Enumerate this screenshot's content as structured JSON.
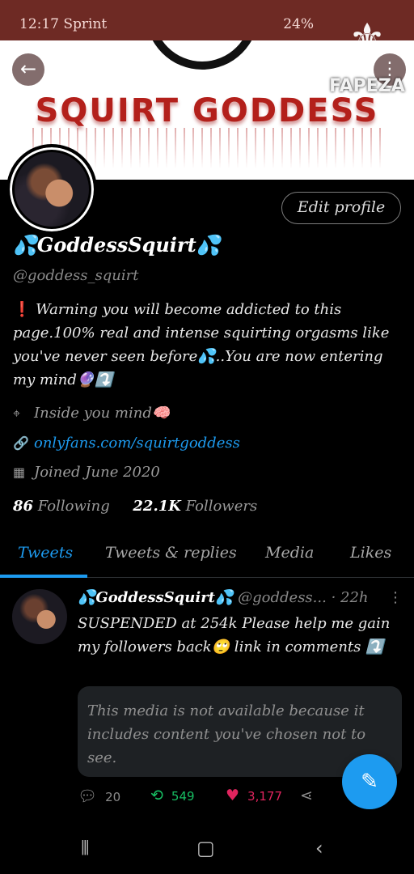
{
  "status_bar": {
    "time": "12:17 Sprint",
    "icons": "⏰ 🔇 ᯤ ▮",
    "battery": "24%"
  },
  "watermark": {
    "text": "FAPEZA"
  },
  "banner": {
    "title": "SQUIRT GODDESS"
  },
  "profile": {
    "edit_label": "Edit profile",
    "display_name": "💦GoddessSquirt💦",
    "handle": "@goddess_squirt",
    "bio_warn": "❗",
    "bio": "Warning you will become addicted to this page.100% real and intense squirting orgasms like you've never seen before💦..You are now entering my mind🔮⤵️",
    "location": "Inside you mind🧠",
    "website": "onlyfans.com/squirtgoddess",
    "joined": "Joined June 2020",
    "following_count": "86",
    "following_label": "Following",
    "followers_count": "22.1K",
    "followers_label": "Followers"
  },
  "tabs": [
    "Tweets",
    "Tweets & replies",
    "Media",
    "Likes"
  ],
  "tweet": {
    "name": "💦GoddessSquirt💦",
    "handle": "@goddess...",
    "time": "· 22h",
    "text": "SUSPENDED at 254k Please help me gain my followers back🙄 link in comments ⤵️",
    "media_notice": "This media is not available because it includes content you've chosen not to see.",
    "replies": "20",
    "retweets": "549",
    "likes": "3,177"
  },
  "icons": {
    "back": "arrow-left-icon",
    "more": "more-vertical-icon",
    "location": "map-pin-icon",
    "link": "link-icon",
    "calendar": "calendar-icon",
    "reply": "reply-icon",
    "retweet": "retweet-icon",
    "like": "heart-icon",
    "share": "share-icon",
    "compose": "compose-icon"
  },
  "colors": {
    "status_bar": "#6e2a24",
    "accent": "#1d9bf0",
    "retweet": "#17bf63",
    "like": "#e0245e"
  }
}
